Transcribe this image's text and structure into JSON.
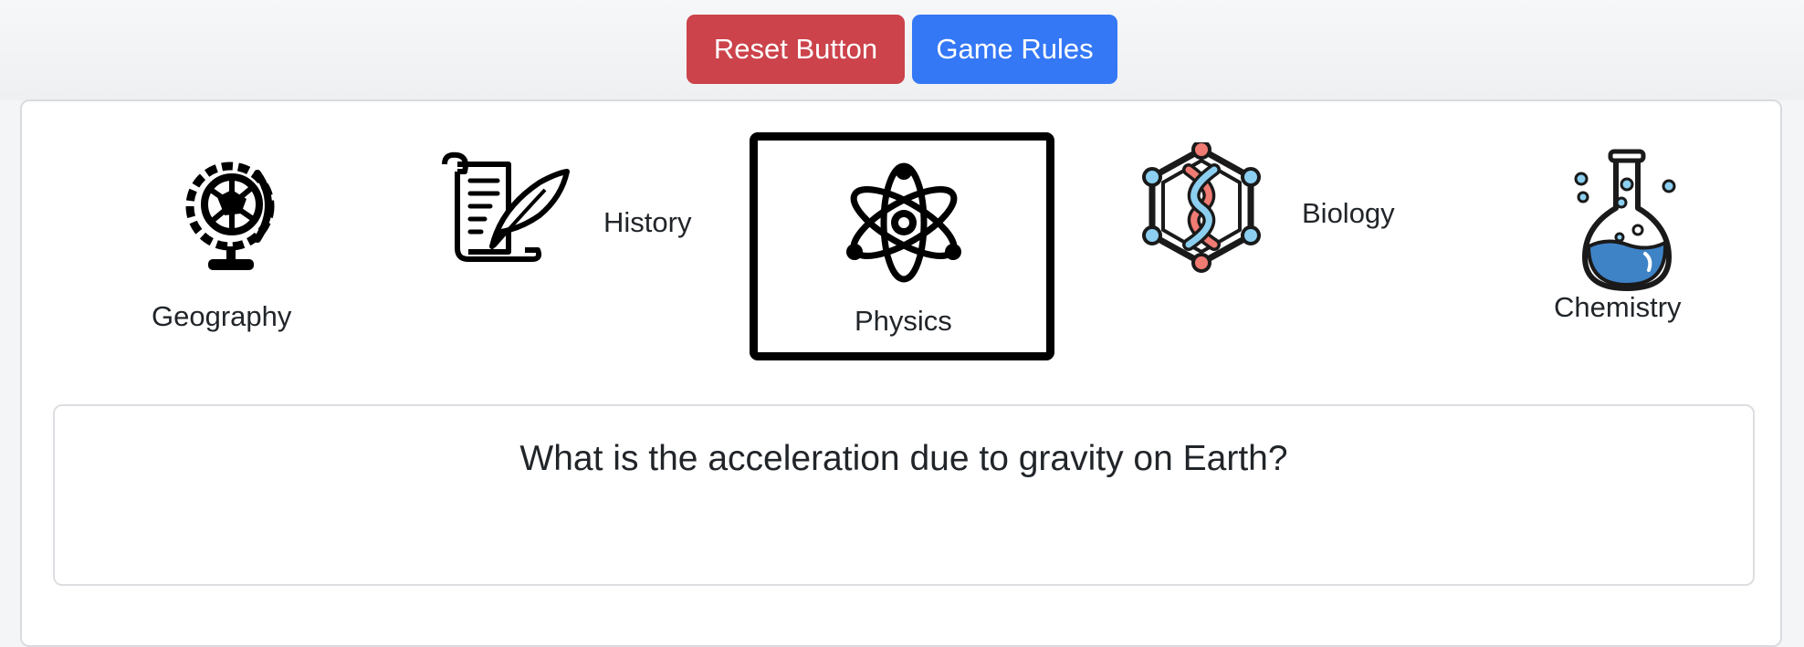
{
  "toolbar": {
    "reset_label": "Reset Button",
    "rules_label": "Game Rules"
  },
  "categories": [
    {
      "label": "Geography",
      "icon": "globe-icon",
      "selected": false
    },
    {
      "label": "History",
      "icon": "scroll-quill-icon",
      "selected": false
    },
    {
      "label": "Physics",
      "icon": "atom-icon",
      "selected": true
    },
    {
      "label": "Biology",
      "icon": "dna-molecule-icon",
      "selected": false
    },
    {
      "label": "Chemistry",
      "icon": "flask-icon",
      "selected": false
    }
  ],
  "question": {
    "text": "What is the acceleration due to gravity on Earth?"
  },
  "colors": {
    "reset": "#cc434b",
    "rules": "#3478f6",
    "dna_red": "#f07b73",
    "dna_blue": "#8ccff0",
    "flask_blue": "#3f83c7"
  }
}
